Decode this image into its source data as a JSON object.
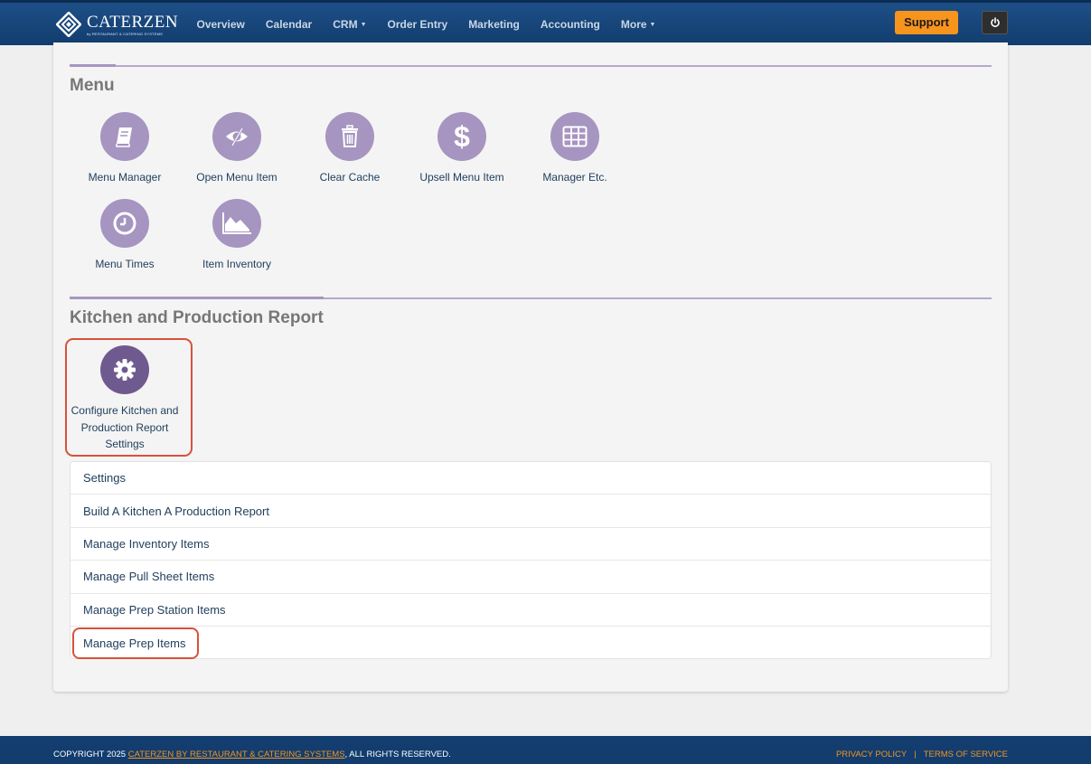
{
  "brand": {
    "title": "CATERZEN",
    "subtitle": "by RESTAURANT & CATERING SYSTEMS"
  },
  "nav": {
    "items": [
      {
        "label": "Overview",
        "dropdown": false
      },
      {
        "label": "Calendar",
        "dropdown": false
      },
      {
        "label": "CRM",
        "dropdown": true
      },
      {
        "label": "Order Entry",
        "dropdown": false
      },
      {
        "label": "Marketing",
        "dropdown": false
      },
      {
        "label": "Accounting",
        "dropdown": false
      },
      {
        "label": "More",
        "dropdown": true
      }
    ],
    "support_label": "Support",
    "power_icon": "power-icon"
  },
  "menu_section": {
    "title": "Menu",
    "tiles": [
      {
        "label": "Menu Manager",
        "icon": "book-icon"
      },
      {
        "label": "Open Menu Item",
        "icon": "eye-slash-icon"
      },
      {
        "label": "Clear Cache",
        "icon": "trash-icon"
      },
      {
        "label": "Upsell Menu Item",
        "icon": "dollar-icon"
      },
      {
        "label": "Manager Etc.",
        "icon": "table-icon"
      },
      {
        "label": "Menu Times",
        "icon": "clock-icon"
      },
      {
        "label": "Item Inventory",
        "icon": "area-chart-icon"
      }
    ]
  },
  "kitchen_section": {
    "title": "Kitchen and Production Report",
    "tile": {
      "label": "Configure Kitchen and Production Report Settings",
      "icon": "gear-icon"
    },
    "list": [
      "Settings",
      "Build A Kitchen A Production Report",
      "Manage Inventory Items",
      "Manage Pull Sheet Items",
      "Manage Prep Station Items",
      "Manage Prep Items"
    ]
  },
  "colors": {
    "nav_bg": "#123d6e",
    "accent": "#f7941d",
    "tile_purple": "#a595c0",
    "tile_dark_purple": "#6f5a8f",
    "highlight": "#d9513b",
    "link_text": "#1e3d5c"
  },
  "footer": {
    "copyright_prefix": "COPYRIGHT 2025 ",
    "company_link": "CATERZEN BY RESTAURANT & CATERING SYSTEMS",
    "rights": ", ALL RIGHTS RESERVED.",
    "privacy": "PRIVACY POLICY",
    "terms": "TERMS OF SERVICE"
  }
}
